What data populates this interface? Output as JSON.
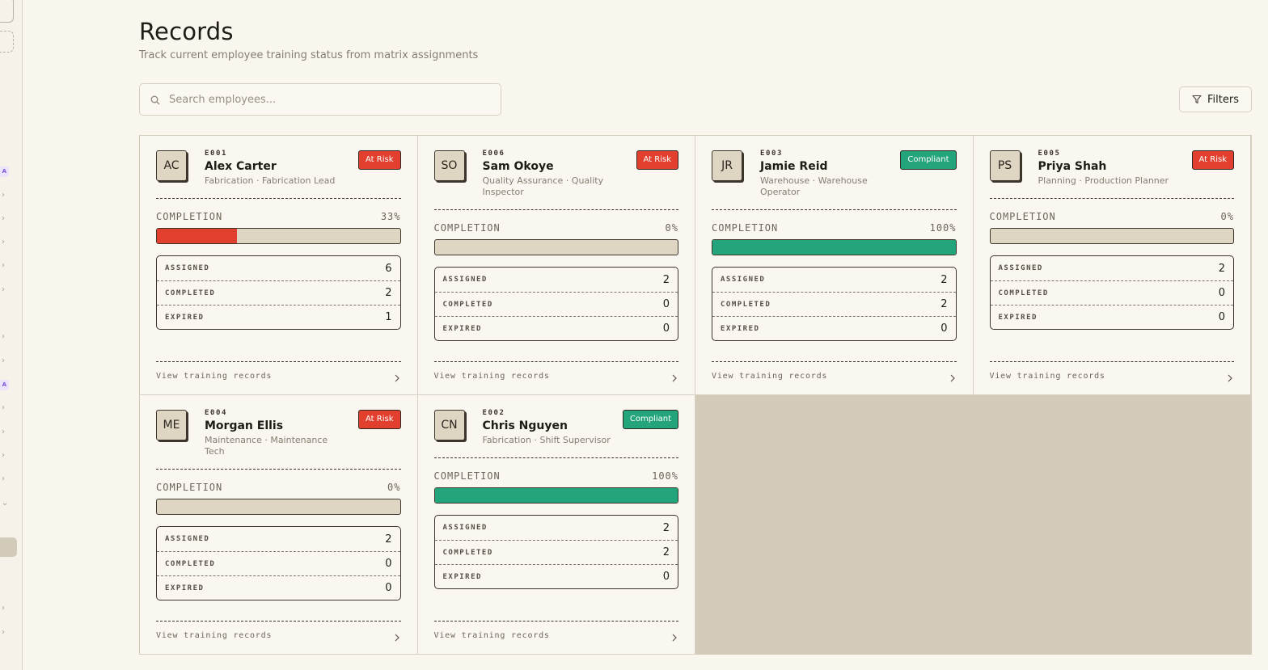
{
  "page": {
    "title": "Records",
    "subtitle": "Track current employee training status from matrix assignments"
  },
  "search": {
    "placeholder": "Search employees...",
    "value": ""
  },
  "toolbar": {
    "filters_label": "Filters"
  },
  "sidebar": {
    "badge_a": "A",
    "badge_b": "A"
  },
  "labels": {
    "completion": "COMPLETION",
    "assigned": "ASSIGNED",
    "completed": "COMPLETED",
    "expired": "EXPIRED",
    "view_records": "View training records"
  },
  "colors": {
    "at_risk": "#e23f2e",
    "compliant": "#23a47b",
    "bar_track": "#ded5c2"
  },
  "employees": [
    {
      "initials": "AC",
      "id": "E001",
      "name": "Alex Carter",
      "dept": "Fabrication · Fabrication Lead",
      "status": "At Risk",
      "status_type": "risk",
      "completion": 33,
      "completion_text": "33%",
      "assigned": "6",
      "completed": "2",
      "expired": "1"
    },
    {
      "initials": "SO",
      "id": "E006",
      "name": "Sam Okoye",
      "dept": "Quality Assurance · Quality Inspector",
      "status": "At Risk",
      "status_type": "risk",
      "completion": 0,
      "completion_text": "0%",
      "assigned": "2",
      "completed": "0",
      "expired": "0"
    },
    {
      "initials": "JR",
      "id": "E003",
      "name": "Jamie Reid",
      "dept": "Warehouse · Warehouse Operator",
      "status": "Compliant",
      "status_type": "ok",
      "completion": 100,
      "completion_text": "100%",
      "assigned": "2",
      "completed": "2",
      "expired": "0"
    },
    {
      "initials": "PS",
      "id": "E005",
      "name": "Priya Shah",
      "dept": "Planning · Production Planner",
      "status": "At Risk",
      "status_type": "risk",
      "completion": 0,
      "completion_text": "0%",
      "assigned": "2",
      "completed": "0",
      "expired": "0"
    },
    {
      "initials": "ME",
      "id": "E004",
      "name": "Morgan Ellis",
      "dept": "Maintenance · Maintenance Tech",
      "status": "At Risk",
      "status_type": "risk",
      "completion": 0,
      "completion_text": "0%",
      "assigned": "2",
      "completed": "0",
      "expired": "0"
    },
    {
      "initials": "CN",
      "id": "E002",
      "name": "Chris Nguyen",
      "dept": "Fabrication · Shift Supervisor",
      "status": "Compliant",
      "status_type": "ok",
      "completion": 100,
      "completion_text": "100%",
      "assigned": "2",
      "completed": "2",
      "expired": "0"
    }
  ]
}
